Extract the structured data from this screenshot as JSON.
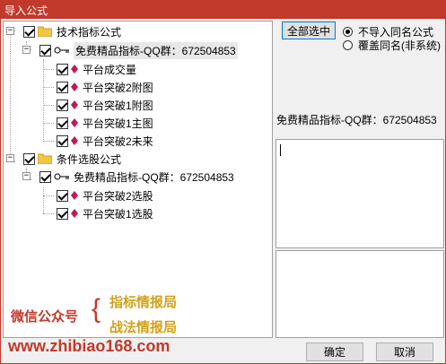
{
  "window": {
    "title": "导入公式"
  },
  "tree": {
    "root1": {
      "label": "技术指标公式"
    },
    "group1": {
      "label": "免费精品指标-QQ群：672504853"
    },
    "items1": [
      "平台成交量",
      "平台突破2附图",
      "平台突破1附图",
      "平台突破1主图",
      "平台突破2未来"
    ],
    "root2": {
      "label": "条件选股公式"
    },
    "group2": {
      "label": "免费精品指标-QQ群：672504853"
    },
    "items2": [
      "平台突破2选股",
      "平台突破1选股"
    ]
  },
  "watermark": {
    "wechat": "微信公众号",
    "brace": "{",
    "line1": "指标情报局",
    "line2": "战法情报局",
    "url": "www.zhibiao168.com"
  },
  "right": {
    "select_all": "全部选中",
    "option1": "不导入同名公式",
    "option2": "覆盖同名(非系统)",
    "info_label": "免费精品指标-QQ群：672504853"
  },
  "buttons": {
    "ok": "确定",
    "cancel": "取消"
  },
  "colors": {
    "title_bar": "#c0392b",
    "watermark_red": "#c0392b",
    "watermark_gold": "#d4a017",
    "gem": "#c2185b"
  }
}
